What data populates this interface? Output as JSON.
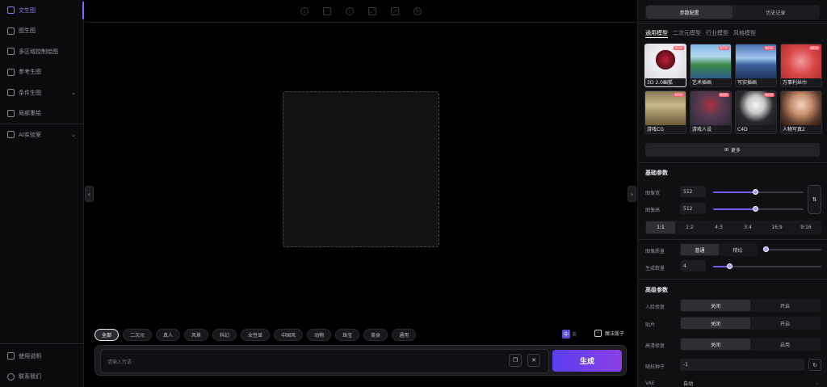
{
  "sidebar": {
    "items": [
      {
        "label": "文生图",
        "icon": "image-text-icon",
        "active": true
      },
      {
        "label": "图生图",
        "icon": "image-icon"
      },
      {
        "label": "多区域控制绘图",
        "icon": "grid-icon"
      },
      {
        "label": "参考生图",
        "icon": "reference-icon"
      },
      {
        "label": "条件生图",
        "icon": "condition-icon",
        "expandable": true
      },
      {
        "label": "局部重绘",
        "icon": "brush-icon"
      },
      {
        "label": "AI实验室",
        "icon": "lab-icon",
        "expandable": true
      }
    ],
    "bottom": [
      {
        "label": "使用说明",
        "icon": "manual-icon"
      },
      {
        "label": "联系我们",
        "icon": "headset-icon"
      }
    ]
  },
  "toolbar": {
    "icons": [
      "download-icon",
      "save-icon",
      "info-icon",
      "fullscreen-icon",
      "export-icon",
      "redo-icon"
    ]
  },
  "tags": [
    "全部",
    "二次元",
    "真人",
    "风景",
    "科幻",
    "女性显",
    "中国风",
    "动物",
    "珠宝",
    "美食",
    "通用"
  ],
  "lang": {
    "zh": "中",
    "en": "英"
  },
  "magic_dice": "魔法骰子",
  "prompt": {
    "placeholder": "请输入咒语",
    "generate": "生成"
  },
  "panel": {
    "top_tabs": [
      "参数配置",
      "历史记录"
    ],
    "model_tabs": [
      "通用模型",
      "二次元模型",
      "行业模型",
      "风格模型"
    ],
    "models": [
      {
        "name": "3D 2.0幽狐",
        "new": true,
        "selected": true
      },
      {
        "name": "艺术插画",
        "new": true
      },
      {
        "name": "写实插画",
        "new": true
      },
      {
        "name": "万事利丝巾",
        "new": true
      },
      {
        "name": "游戏CG",
        "new": true
      },
      {
        "name": "游戏人设",
        "new": true
      },
      {
        "name": "C4D",
        "new": true
      },
      {
        "name": "人物写真2",
        "new": false
      }
    ],
    "new_badge": "NEW",
    "more": "更多",
    "basic_title": "基础参数",
    "width_label": "图像宽",
    "width_value": "512",
    "height_label": "图像高",
    "height_value": "512",
    "ratios": [
      "1:1",
      "1:2",
      "4:3",
      "3:4",
      "16:9",
      "9:16"
    ],
    "quality_label": "图像质量",
    "quality_options": [
      "普通",
      "精绘"
    ],
    "count_label": "生成数量",
    "count_value": "4",
    "advanced_title": "高级参数",
    "face_label": "人脸修复",
    "face_options": [
      "关闭",
      "开启"
    ],
    "tile_label": "贴片",
    "tile_options": [
      "关闭",
      "开启"
    ],
    "hires_label": "高清修复",
    "hires_options": [
      "关闭",
      "启用"
    ],
    "seed_label": "随机种子",
    "seed_value": "-1",
    "vae_label": "VAE",
    "vae_value": "自动"
  },
  "colors": {
    "accent": "#7c6cf5",
    "generate_start": "#5a3ff0",
    "generate_end": "#8b3fe6",
    "new_badge": "#ff5a6a"
  }
}
